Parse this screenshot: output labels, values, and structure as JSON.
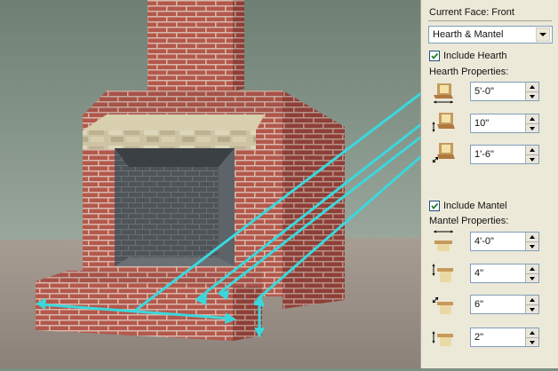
{
  "panel": {
    "face_label": "Current Face: Front",
    "face_select": {
      "selected": "Hearth & Mantel"
    },
    "include_hearth": {
      "label": "Include Hearth",
      "checked": true
    },
    "hearth_heading": "Hearth Properties:",
    "hearth_props": [
      {
        "icon": "hearth-width-icon",
        "value": "5'-0\""
      },
      {
        "icon": "hearth-height-icon",
        "value": "10\""
      },
      {
        "icon": "hearth-depth-icon",
        "value": "1'-6\""
      }
    ],
    "include_mantel": {
      "label": "Include Mantel",
      "checked": true
    },
    "mantel_heading": "Mantel Properties:",
    "mantel_props": [
      {
        "icon": "mantel-width-icon",
        "value": "4'-0\""
      },
      {
        "icon": "mantel-height-icon",
        "value": "4\""
      },
      {
        "icon": "mantel-depth-icon",
        "value": "6\""
      },
      {
        "icon": "mantel-offset-icon",
        "value": "2\""
      }
    ]
  },
  "colors": {
    "panel_bg": "#ece9d8",
    "brick": "#b0544a",
    "callout_line": "#3ad8dc",
    "input_border": "#7f9db9"
  }
}
